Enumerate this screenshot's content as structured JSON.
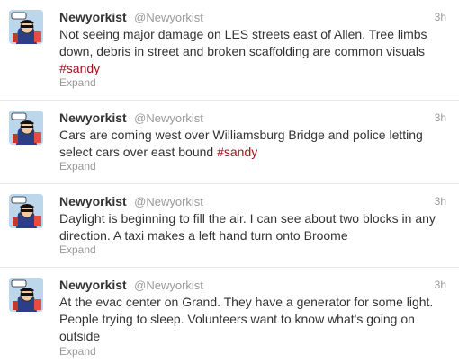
{
  "tweets": [
    {
      "fullname": "Newyorkist",
      "username": "@Newyorkist",
      "time": "3h",
      "text": "Not seeing major damage on LES streets east of Allen. Tree limbs down, debris in street and broken scaffolding are common visuals",
      "hashtag": "#sandy",
      "expand": "Expand"
    },
    {
      "fullname": "Newyorkist",
      "username": "@Newyorkist",
      "time": "3h",
      "text": "Cars are coming west over Williamsburg Bridge and police letting select cars over east bound",
      "hashtag": "#sandy",
      "expand": "Expand"
    },
    {
      "fullname": "Newyorkist",
      "username": "@Newyorkist",
      "time": "3h",
      "text": "Daylight is beginning to fill the air. I can see about two blocks in any direction. A taxi makes a left hand turn onto Broome",
      "expand": "Expand"
    },
    {
      "fullname": "Newyorkist",
      "username": "@Newyorkist",
      "time": "3h",
      "text": "At the evac center on Grand. They have a generator for some light. People trying to sleep. Volunteers want to know what's going on outside",
      "expand": "Expand"
    }
  ],
  "colors": {
    "hashtag": "#a3111a",
    "meta": "#999999",
    "text": "#333333",
    "divider": "#e8e8e8"
  }
}
